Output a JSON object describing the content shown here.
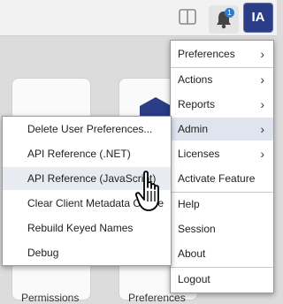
{
  "header": {
    "notification_count": "1",
    "user_initials": "IA",
    "accent": "#2a3d86"
  },
  "cards": [
    {
      "label": "Permissions"
    },
    {
      "label": "Preferences"
    }
  ],
  "main_menu": {
    "items": [
      {
        "label": "Preferences",
        "has_submenu": true
      },
      {
        "label": "Actions",
        "has_submenu": true
      },
      {
        "label": "Reports",
        "has_submenu": true
      },
      {
        "label": "Admin",
        "has_submenu": true,
        "active": true
      },
      {
        "label": "Licenses",
        "has_submenu": true
      },
      {
        "label": "Activate Feature",
        "has_submenu": false
      },
      {
        "label": "Help",
        "has_submenu": false
      },
      {
        "label": "Session",
        "has_submenu": false
      },
      {
        "label": "About",
        "has_submenu": false
      },
      {
        "label": "Logout",
        "has_submenu": false
      }
    ]
  },
  "admin_submenu": {
    "items": [
      {
        "label": "Delete User Preferences..."
      },
      {
        "label": "API Reference (.NET)"
      },
      {
        "label": "API Reference (JavaScript)",
        "hovered": true
      },
      {
        "label": "Clear Client Metadata Cache"
      },
      {
        "label": "Rebuild Keyed Names"
      },
      {
        "label": "Debug"
      }
    ]
  },
  "icons": [
    "panel-toggle-icon",
    "bell-icon",
    "chevron-right-icon",
    "hand-pointer-icon",
    "hexagon-icon"
  ]
}
